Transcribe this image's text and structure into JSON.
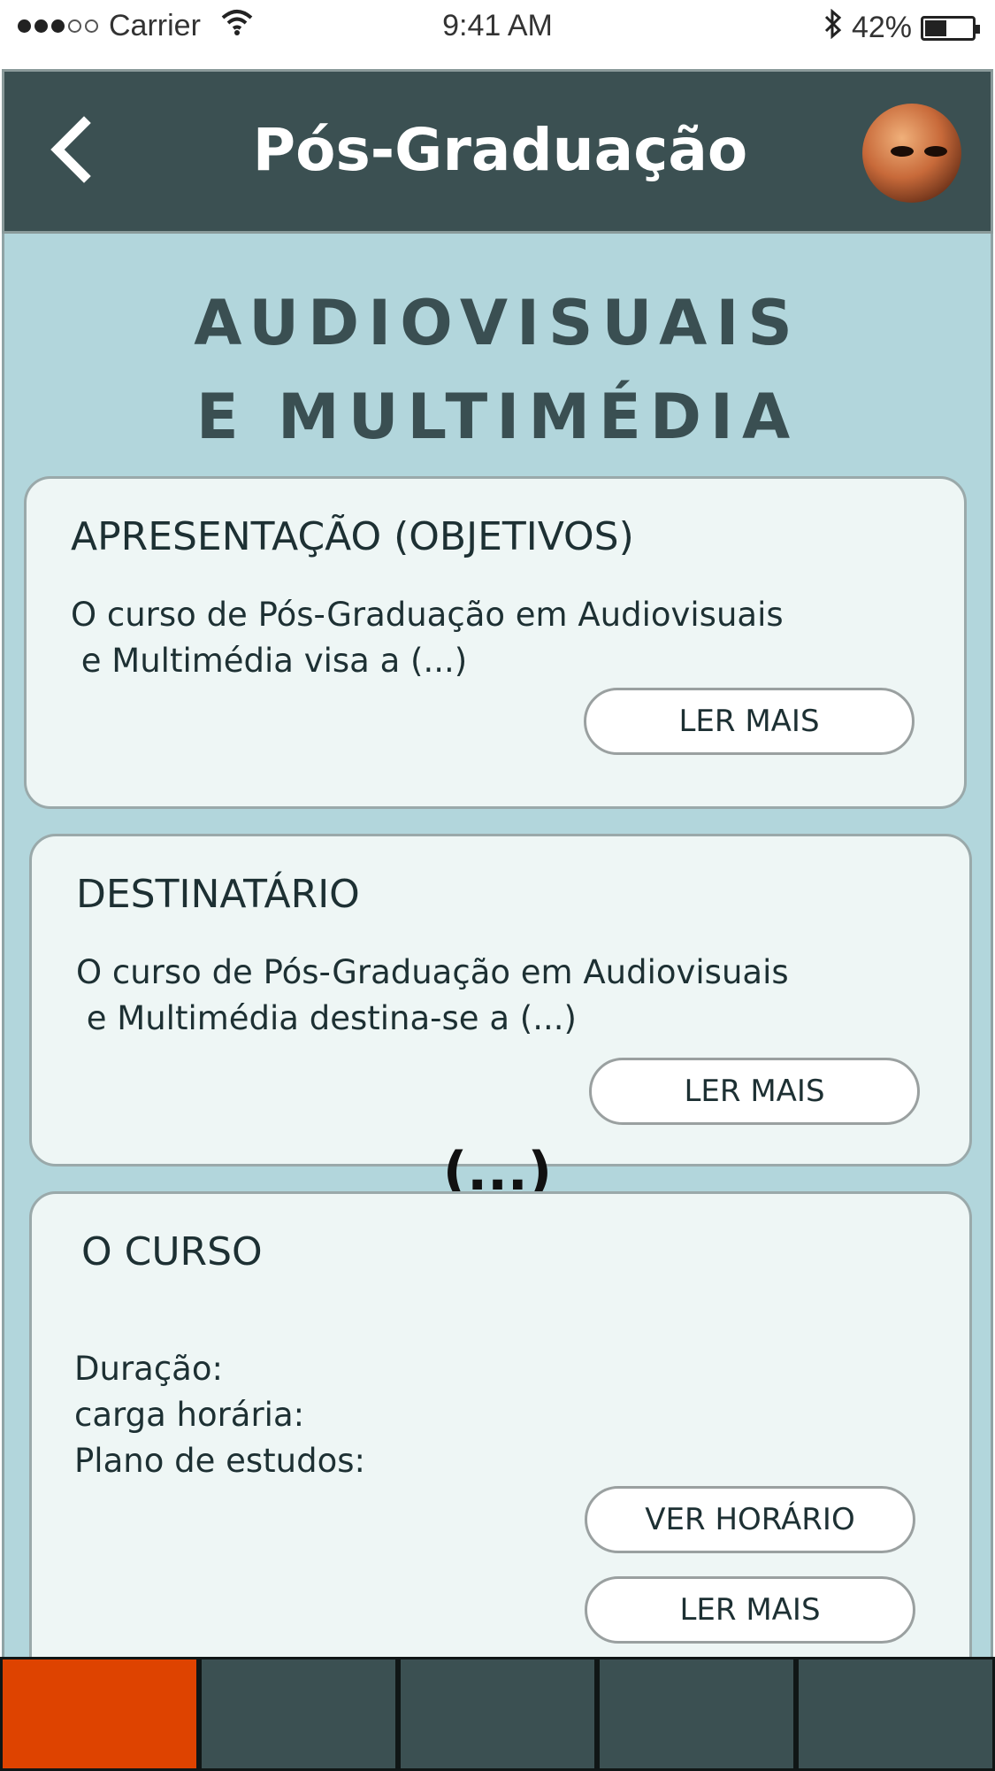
{
  "status_bar": {
    "carrier": "Carrier",
    "time": "9:41 AM",
    "battery": "42%",
    "battery_level": 0.42
  },
  "header": {
    "title": "Pós-Graduação",
    "back_icon": "chevron-left-icon",
    "avatar_alt": "profile avatar"
  },
  "page": {
    "heading_line1": "AUDIOVISUAIS",
    "heading_line2": "E MULTIMÉDIA",
    "ellipsis": "(...)"
  },
  "cards": [
    {
      "title": "APRESENTAÇÃO (OBJETIVOS)",
      "text_line1": "O curso de Pós-Graduação em Audiovisuais",
      "text_line2": " e Multimédia visa a (...)",
      "button": "LER MAIS"
    },
    {
      "title": "DESTINATÁRIO",
      "text_line1": "O curso de Pós-Graduação em Audiovisuais",
      "text_line2": " e Multimédia destina-se a (...)",
      "button": "LER MAIS"
    },
    {
      "title": "O CURSO",
      "duration_label": "Duração:",
      "workload_label": "carga horária:",
      "plan_label": "Plano de estudos:",
      "schedule_button": "VER HORÁRIO",
      "button": "LER MAIS"
    }
  ],
  "tabbar": {
    "tab_count": 5,
    "active_index": 0,
    "active_color": "#de4300",
    "inactive_color": "#3b5052"
  },
  "colors": {
    "header_bg": "#3b5052",
    "content_bg": "#b2d6dc",
    "card_bg": "#eef6f5"
  }
}
